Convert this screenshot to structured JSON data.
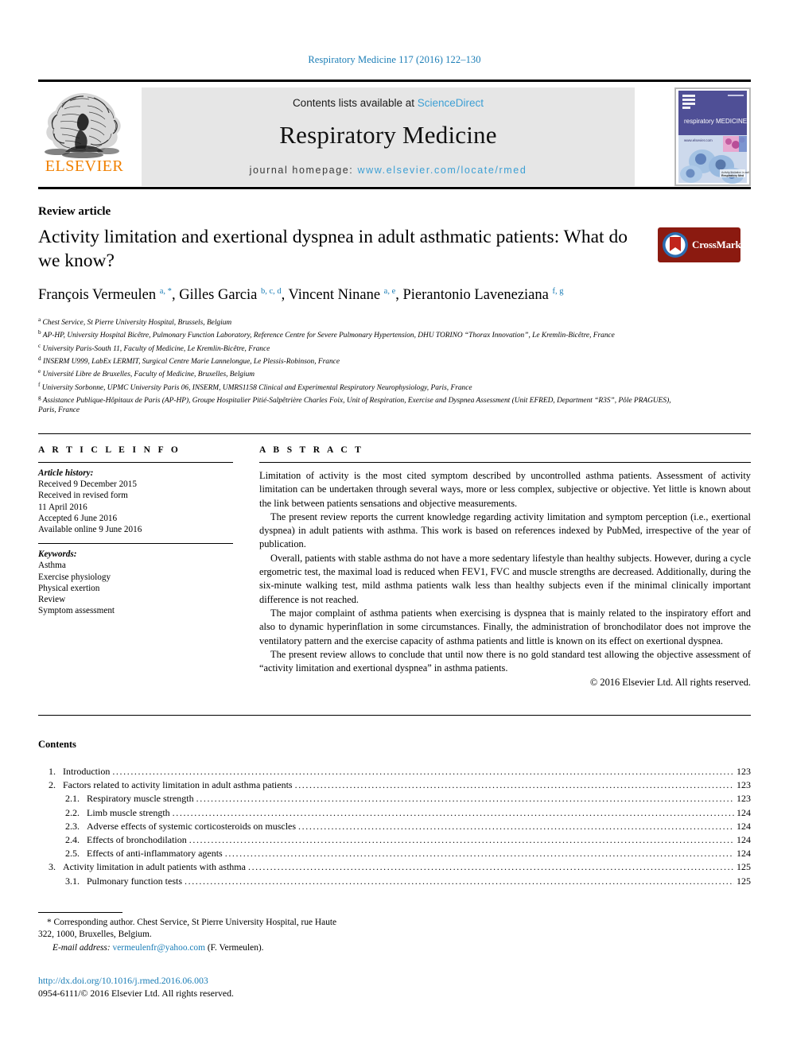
{
  "running_head": "Respiratory Medicine 117 (2016) 122–130",
  "masthead": {
    "publisher": "ELSEVIER",
    "contents_prefix": "Contents lists available at ",
    "contents_link": "ScienceDirect",
    "journal_title": "Respiratory Medicine",
    "homepage_prefix": "journal homepage: ",
    "homepage_url": "www.elsevier.com/locate/rmed",
    "cover_title": "respiratory MEDICINE",
    "cover_url": "www.elsevier.com",
    "tree_icon": "elsevier-tree-icon"
  },
  "article": {
    "type": "Review article",
    "title": "Activity limitation and exertional dyspnea in adult asthmatic patients: What do we know?",
    "crossmark_label": "CrossMark",
    "authors_html": "François Vermeulen <sup>a, *</sup>, Gilles Garcia <sup>b, c, d</sup>, Vincent Ninane <sup>a, e</sup>, Pierantonio Laveneziana <sup>f, g</sup>",
    "affiliations": [
      {
        "mark": "a",
        "text": "Chest Service, St Pierre University Hospital, Brussels, Belgium"
      },
      {
        "mark": "b",
        "text": "AP-HP, University Hospital Bicêtre, Pulmonary Function Laboratory, Reference Centre for Severe Pulmonary Hypertension, DHU TORINO “Thorax Innovation”, Le Kremlin-Bicêtre, France"
      },
      {
        "mark": "c",
        "text": "University Paris-South 11, Faculty of Medicine, Le Kremlin-Bicêtre, France"
      },
      {
        "mark": "d",
        "text": "INSERM U999, LabEx LERMIT, Surgical Centre Marie Lannelongue, Le Plessis-Robinson, France"
      },
      {
        "mark": "e",
        "text": "Université Libre de Bruxelles, Faculty of Medicine, Bruxelles, Belgium"
      },
      {
        "mark": "f",
        "text": "University Sorbonne, UPMC University Paris 06, INSERM, UMRS1158 Clinical and Experimental Respiratory Neurophysiology, Paris, France"
      },
      {
        "mark": "g",
        "text": "Assistance Publique-Hôpitaux de Paris (AP-HP), Groupe Hospitalier Pitié-Salpêtrière Charles Foix, Unit of Respiration, Exercise and Dyspnea Assessment (Unit EFRED, Department “R3S”, Pôle PRAGUES), Paris, France"
      }
    ]
  },
  "article_info": {
    "heading": "A R T I C L E  I N F O",
    "history_label": "Article history:",
    "history": [
      "Received 9 December 2015",
      "Received in revised form",
      "11 April 2016",
      "Accepted 6 June 2016",
      "Available online 9 June 2016"
    ],
    "keywords_label": "Keywords:",
    "keywords": [
      "Asthma",
      "Exercise physiology",
      "Physical exertion",
      "Review",
      "Symptom assessment"
    ]
  },
  "abstract": {
    "heading": "A B S T R A C T",
    "paragraphs": [
      "Limitation of activity is the most cited symptom described by uncontrolled asthma patients. Assessment of activity limitation can be undertaken through several ways, more or less complex, subjective or objective. Yet little is known about the link between patients sensations and objective measurements.",
      "The present review reports the current knowledge regarding activity limitation and symptom perception (i.e., exertional dyspnea) in adult patients with asthma. This work is based on references indexed by PubMed, irrespective of the year of publication.",
      "Overall, patients with stable asthma do not have a more sedentary lifestyle than healthy subjects. However, during a cycle ergometric test, the maximal load is reduced when FEV1, FVC and muscle strengths are decreased. Additionally, during the six-minute walking test, mild asthma patients walk less than healthy subjects even if the minimal clinically important difference is not reached.",
      "The major complaint of asthma patients when exercising is dyspnea that is mainly related to the inspiratory effort and also to dynamic hyperinflation in some circumstances. Finally, the administration of bronchodilator does not improve the ventilatory pattern and the exercise capacity of asthma patients and little is known on its effect on exertional dyspnea.",
      "The present review allows to conclude that until now there is no gold standard test allowing the objective assessment of “activity limitation and exertional dyspnea” in asthma patients."
    ],
    "copyright": "© 2016 Elsevier Ltd. All rights reserved."
  },
  "contents": {
    "heading": "Contents",
    "entries": [
      {
        "num": "1.",
        "level": 1,
        "text": "Introduction",
        "page": "123"
      },
      {
        "num": "2.",
        "level": 1,
        "text": "Factors related to activity limitation in adult asthma patients",
        "page": "123"
      },
      {
        "num": "2.1.",
        "level": 2,
        "text": "Respiratory muscle strength",
        "page": "123"
      },
      {
        "num": "2.2.",
        "level": 2,
        "text": "Limb muscle strength",
        "page": "124"
      },
      {
        "num": "2.3.",
        "level": 2,
        "text": "Adverse effects of systemic corticosteroids on muscles",
        "page": "124"
      },
      {
        "num": "2.4.",
        "level": 2,
        "text": "Effects of bronchodilation",
        "page": "124"
      },
      {
        "num": "2.5.",
        "level": 2,
        "text": "Effects of anti-inflammatory agents",
        "page": "124"
      },
      {
        "num": "3.",
        "level": 1,
        "text": "Activity limitation in adult patients with asthma",
        "page": "125"
      },
      {
        "num": "3.1.",
        "level": 2,
        "text": "Pulmonary function tests",
        "page": "125"
      }
    ]
  },
  "footer": {
    "corresponding_line1": "* Corresponding author. Chest Service, St Pierre University Hospital, rue Haute",
    "corresponding_line2": "322, 1000, Bruxelles, Belgium.",
    "email_label": "E-mail address:",
    "email": "vermeulenfr@yahoo.com",
    "email_owner": "(F. Vermeulen).",
    "doi": "http://dx.doi.org/10.1016/j.rmed.2016.06.003",
    "issn_line": "0954-6111/© 2016 Elsevier Ltd. All rights reserved."
  },
  "colors": {
    "link": "#1a7db6",
    "science_direct": "#3c9fd4",
    "elsevier_orange": "#f08000",
    "panel_gray": "#e6e6e6",
    "crossmark_red": "#8b1a10"
  }
}
